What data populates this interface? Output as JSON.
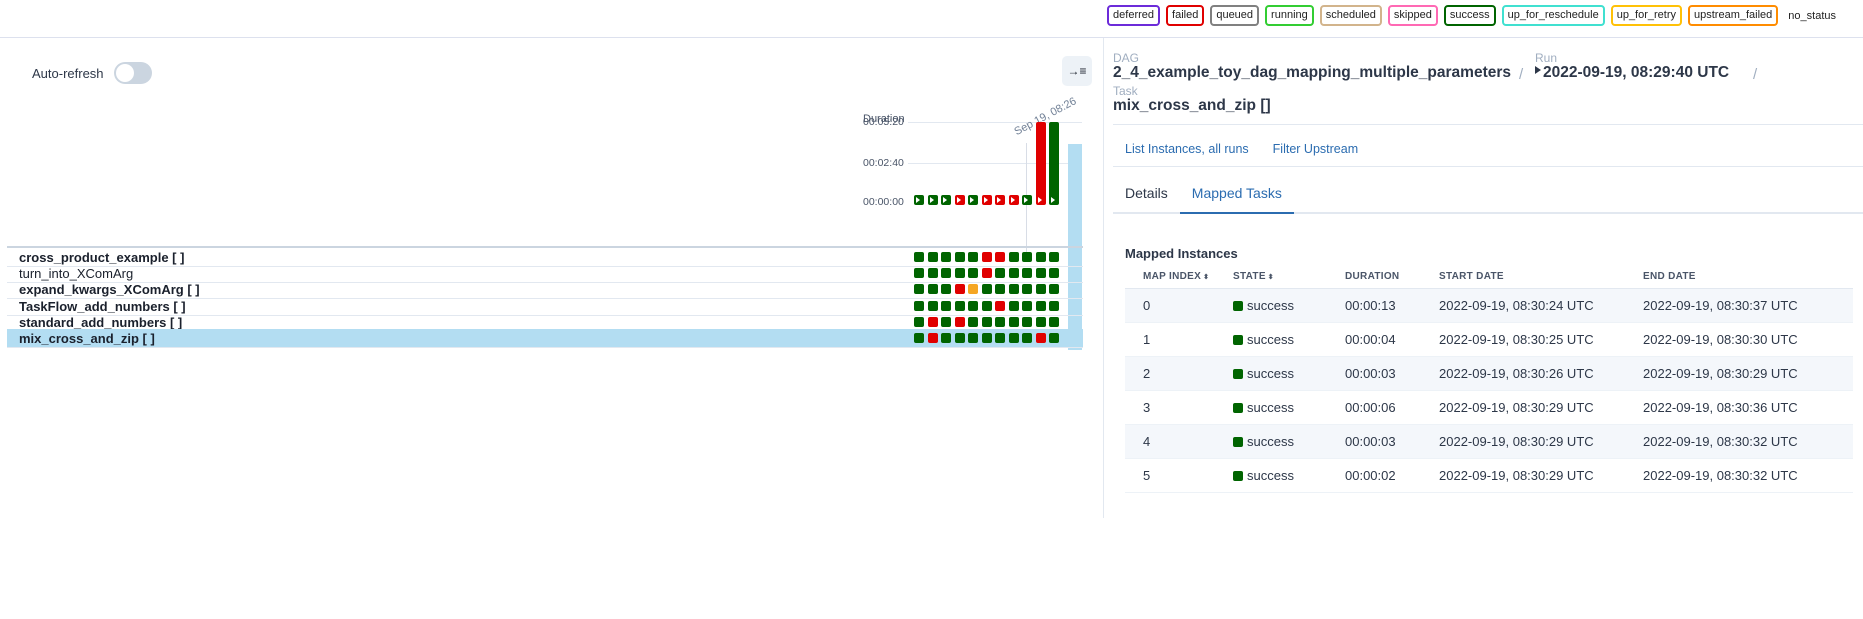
{
  "legend": {
    "items": [
      {
        "label": "deferred",
        "color": "#6c2bd9"
      },
      {
        "label": "failed",
        "color": "#e00000"
      },
      {
        "label": "queued",
        "color": "#808080"
      },
      {
        "label": "running",
        "color": "#32cd32"
      },
      {
        "label": "scheduled",
        "color": "#d2b48c"
      },
      {
        "label": "skipped",
        "color": "#ff69b4"
      },
      {
        "label": "success",
        "color": "#006400"
      },
      {
        "label": "up_for_reschedule",
        "color": "#40e0d0"
      },
      {
        "label": "up_for_retry",
        "color": "#ffc107"
      },
      {
        "label": "upstream_failed",
        "color": "#ff8c00"
      }
    ],
    "no_status_label": "no_status"
  },
  "grid": {
    "auto_refresh_label": "Auto-refresh",
    "collapse_icon": "→≡",
    "duration_label": "Duration",
    "y_ticks": [
      "00:05:20",
      "00:02:40",
      "00:00:00"
    ],
    "run_date_label": "Sep 19, 08:26",
    "colors": {
      "success": "#006400",
      "failed": "#e00000",
      "upstream_failed": "#f5a623"
    },
    "run_durations_s": [
      24,
      10,
      10,
      14,
      10,
      10,
      10,
      10,
      10,
      320,
      320
    ],
    "run_states": [
      "success",
      "success",
      "success",
      "failed",
      "success",
      "failed",
      "failed",
      "failed",
      "success",
      "failed",
      "success"
    ],
    "tasks": [
      {
        "name": "cross_product_example [ ]",
        "bold": true,
        "states": [
          "success",
          "success",
          "success",
          "success",
          "success",
          "failed",
          "failed",
          "success",
          "success",
          "success",
          "success"
        ]
      },
      {
        "name": "turn_into_XComArg",
        "bold": false,
        "states": [
          "success",
          "success",
          "success",
          "success",
          "success",
          "failed",
          "success",
          "success",
          "success",
          "success",
          "success"
        ]
      },
      {
        "name": "expand_kwargs_XComArg [ ]",
        "bold": true,
        "states": [
          "success",
          "success",
          "success",
          "failed",
          "upstream_failed",
          "success",
          "success",
          "success",
          "success",
          "success",
          "success"
        ]
      },
      {
        "name": "TaskFlow_add_numbers [ ]",
        "bold": true,
        "states": [
          "success",
          "success",
          "success",
          "success",
          "success",
          "success",
          "failed",
          "success",
          "success",
          "success",
          "success"
        ]
      },
      {
        "name": "standard_add_numbers [ ]",
        "bold": true,
        "states": [
          "success",
          "failed",
          "success",
          "failed",
          "success",
          "success",
          "success",
          "success",
          "success",
          "success",
          "success"
        ]
      },
      {
        "name": "mix_cross_and_zip [ ]",
        "bold": true,
        "states": [
          "success",
          "failed",
          "success",
          "success",
          "success",
          "success",
          "success",
          "success",
          "success",
          "failed",
          "success"
        ]
      }
    ]
  },
  "details": {
    "breadcrumb": {
      "dag_label": "DAG",
      "dag_value": "2_4_example_toy_dag_mapping_multiple_parameters",
      "run_label": "Run",
      "run_value": "2022-09-19, 08:29:40 UTC",
      "task_label": "Task",
      "task_value": "mix_cross_and_zip []",
      "separator": "/"
    },
    "links": [
      "List Instances, all runs",
      "Filter Upstream"
    ],
    "tabs": [
      "Details",
      "Mapped Tasks"
    ],
    "active_tab": "Mapped Tasks",
    "section_title": "Mapped Instances",
    "table": {
      "columns": [
        "MAP INDEX",
        "STATE",
        "DURATION",
        "START DATE",
        "END DATE"
      ],
      "sort_icon": "⬍",
      "rows": [
        {
          "index": "0",
          "state": "success",
          "duration": "00:00:13",
          "start": "2022-09-19, 08:30:24 UTC",
          "end": "2022-09-19, 08:30:37 UTC"
        },
        {
          "index": "1",
          "state": "success",
          "duration": "00:00:04",
          "start": "2022-09-19, 08:30:25 UTC",
          "end": "2022-09-19, 08:30:30 UTC"
        },
        {
          "index": "2",
          "state": "success",
          "duration": "00:00:03",
          "start": "2022-09-19, 08:30:26 UTC",
          "end": "2022-09-19, 08:30:29 UTC"
        },
        {
          "index": "3",
          "state": "success",
          "duration": "00:00:06",
          "start": "2022-09-19, 08:30:29 UTC",
          "end": "2022-09-19, 08:30:36 UTC"
        },
        {
          "index": "4",
          "state": "success",
          "duration": "00:00:03",
          "start": "2022-09-19, 08:30:29 UTC",
          "end": "2022-09-19, 08:30:32 UTC"
        },
        {
          "index": "5",
          "state": "success",
          "duration": "00:00:02",
          "start": "2022-09-19, 08:30:29 UTC",
          "end": "2022-09-19, 08:30:32 UTC"
        }
      ]
    }
  }
}
